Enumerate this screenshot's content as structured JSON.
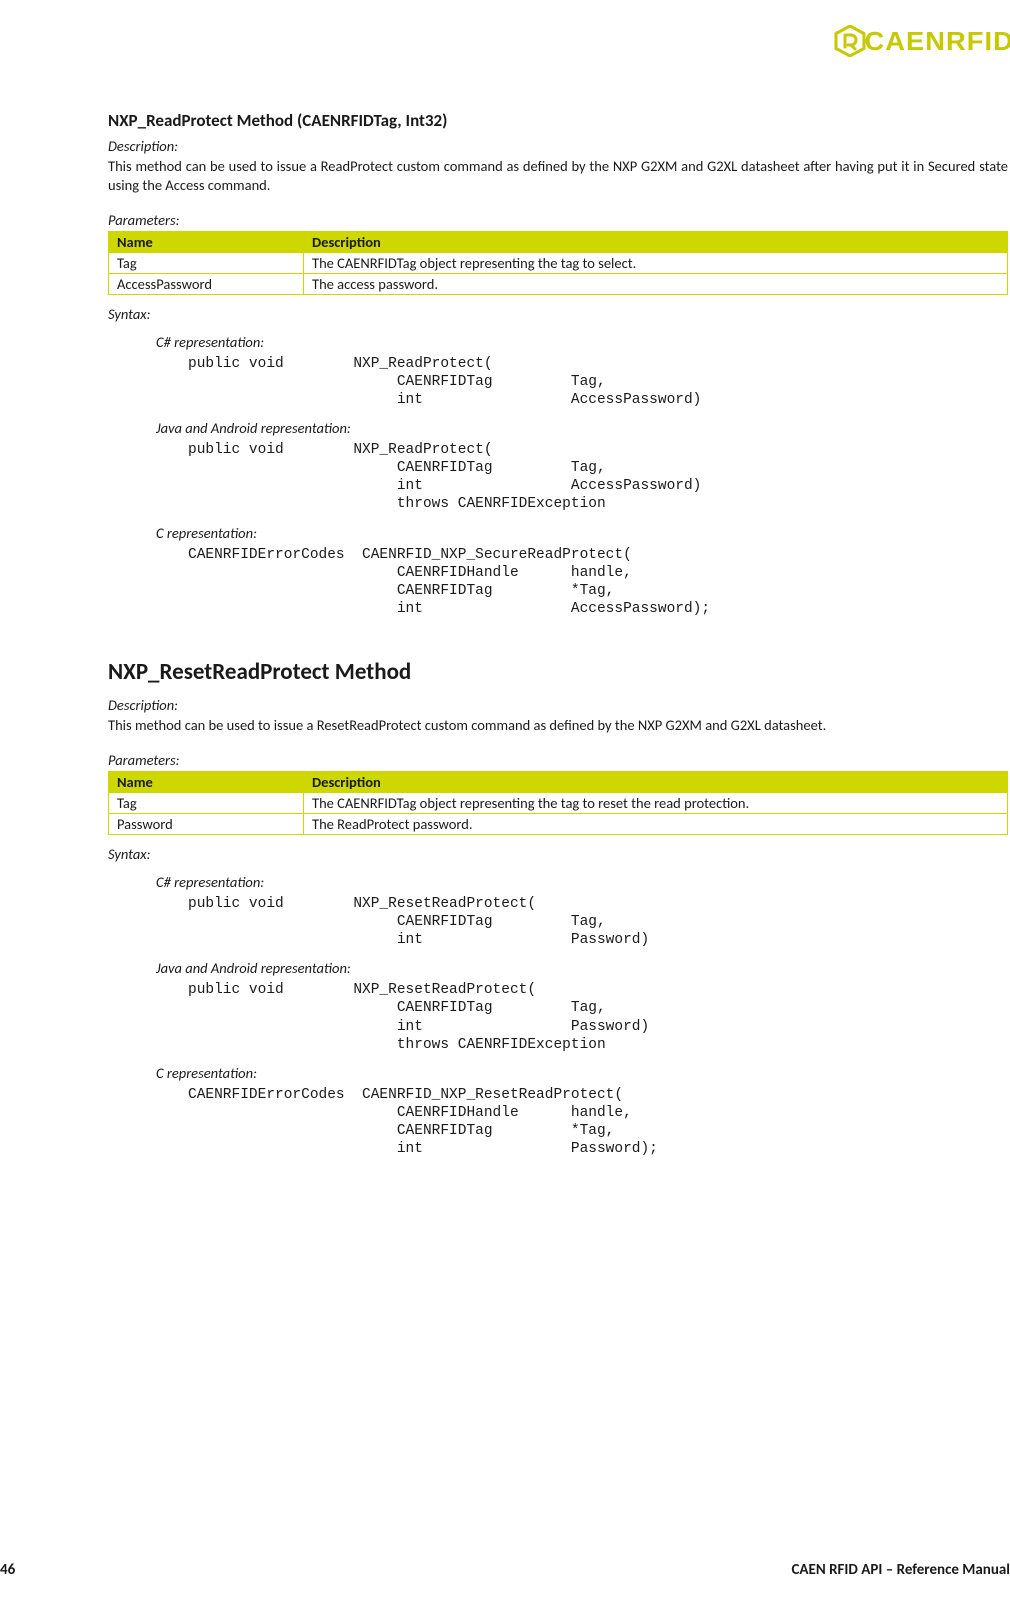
{
  "brand": {
    "name": "CAENRFID"
  },
  "footer": {
    "page": "46",
    "title": "CAEN RFID API – Reference Manual"
  },
  "section1": {
    "title": "NXP_ReadProtect Method (CAENRFIDTag, Int32)",
    "description_label": "Description:",
    "description": "This method can be used to issue a ReadProtect custom command as defined by the NXP G2XM and G2XL datasheet after having put it in Secured state using the Access command.",
    "parameters_label": "Parameters:",
    "table": {
      "headers": [
        "Name",
        "Description"
      ],
      "rows": [
        [
          "Tag",
          "The CAENRFIDTag object representing the tag to select."
        ],
        [
          "AccessPassword",
          "The access password."
        ]
      ]
    },
    "syntax_label": "Syntax:",
    "reps": {
      "csharp_label": "C# representation:",
      "csharp_code": "public void        NXP_ReadProtect(\n                        CAENRFIDTag         Tag,\n                        int                 AccessPassword)",
      "java_label": "Java and Android representation:",
      "java_code": "public void        NXP_ReadProtect(\n                        CAENRFIDTag         Tag,\n                        int                 AccessPassword)\n                        throws CAENRFIDException",
      "c_label": "C representation:",
      "c_code": "CAENRFIDErrorCodes  CAENRFID_NXP_SecureReadProtect(\n                        CAENRFIDHandle      handle,\n                        CAENRFIDTag         *Tag,\n                        int                 AccessPassword);"
    }
  },
  "section2": {
    "title": "NXP_ResetReadProtect Method",
    "description_label": "Description:",
    "description": "This method can be used to issue a ResetReadProtect custom command as defined by the NXP G2XM and G2XL datasheet.",
    "parameters_label": "Parameters:",
    "table": {
      "headers": [
        "Name",
        "Description"
      ],
      "rows": [
        [
          "Tag",
          "The CAENRFIDTag object representing the tag to reset the read protection."
        ],
        [
          "Password",
          "The ReadProtect password."
        ]
      ]
    },
    "syntax_label": "Syntax:",
    "reps": {
      "csharp_label": "C# representation:",
      "csharp_code": "public void        NXP_ResetReadProtect(\n                        CAENRFIDTag         Tag,\n                        int                 Password)",
      "java_label": "Java and Android representation:",
      "java_code": "public void        NXP_ResetReadProtect(\n                        CAENRFIDTag         Tag,\n                        int                 Password)\n                        throws CAENRFIDException",
      "c_label": "C representation:",
      "c_code": "CAENRFIDErrorCodes  CAENRFID_NXP_ResetReadProtect(\n                        CAENRFIDHandle      handle,\n                        CAENRFIDTag         *Tag,\n                        int                 Password);"
    }
  }
}
